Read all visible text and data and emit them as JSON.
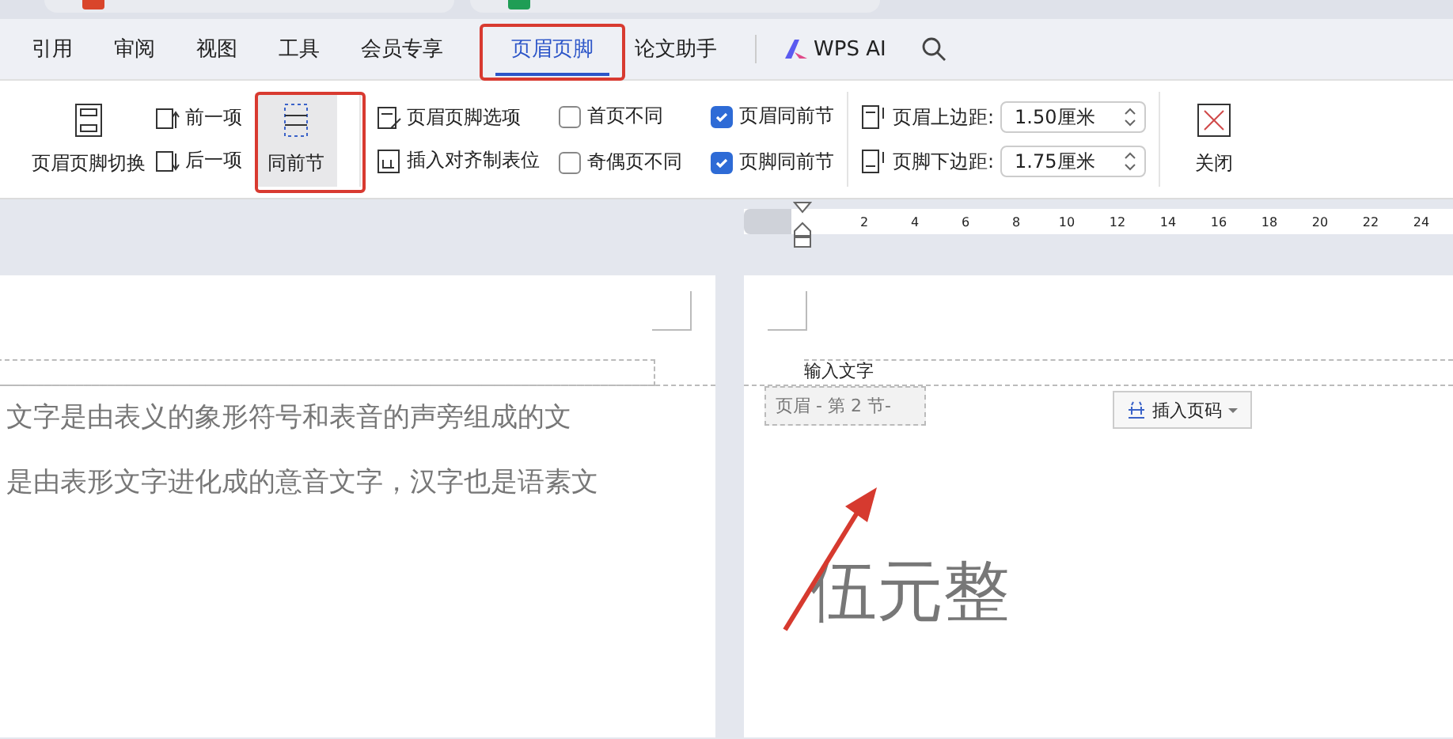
{
  "menu": [
    {
      "label": "引用",
      "selected": false
    },
    {
      "label": "审阅",
      "selected": false
    },
    {
      "label": "视图",
      "selected": false
    },
    {
      "label": "工具",
      "selected": false
    },
    {
      "label": "会员专享",
      "selected": false
    },
    {
      "label": "页眉页脚",
      "selected": true
    },
    {
      "label": "论文助手",
      "selected": false
    }
  ],
  "ai_label": "WPS AI",
  "ribbon": {
    "switch_label": "页眉页脚切换",
    "prev_label": "前一项",
    "next_label": "后一项",
    "same_as_previous": {
      "label": "同前节",
      "selected": true
    },
    "options_label": "页眉页脚选项",
    "tab_label": "插入对齐制表位",
    "checkboxes": [
      {
        "label": "首页不同",
        "checked": false
      },
      {
        "label": "奇偶页不同",
        "checked": false
      },
      {
        "label": "页眉同前节",
        "checked": true
      },
      {
        "label": "页脚同前节",
        "checked": true
      }
    ],
    "margins": [
      {
        "kind": "top",
        "label": "页眉上边距:",
        "value": "1.50厘米"
      },
      {
        "kind": "bottom",
        "label": "页脚下边距:",
        "value": "1.75厘米"
      }
    ],
    "close_label": "关闭"
  },
  "ruler": [
    "2",
    "4",
    "6",
    "8",
    "10",
    "12",
    "14",
    "16",
    "18",
    "20",
    "22",
    "24"
  ],
  "left_page": {
    "lines": [
      "文字是由表义的象形符号和表音的声旁组成的文",
      "是由表形文字进化成的意音文字，汉字也是语素文"
    ]
  },
  "right_page": {
    "header_text": "输入文字",
    "header_tag": "页眉  - 第 2 节-",
    "insert_page_number": "插入页码",
    "body_text": "伍元整"
  }
}
